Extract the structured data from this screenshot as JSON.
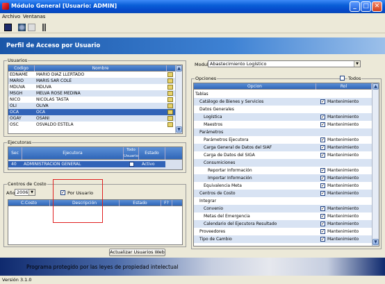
{
  "window": {
    "title": "Módulo General [Usuario: ADMIN]",
    "min": "_",
    "max": "□",
    "close": "✕"
  },
  "menu": [
    "Archivo",
    "Ventanas"
  ],
  "banner": {
    "title": "Perfil de Acceso por Usuario"
  },
  "usuarios": {
    "label": "Usuarios",
    "columns": [
      "Codigo",
      "Nombre"
    ],
    "rows": [
      {
        "codigo": "EDNAME",
        "nombre": "MARIO DIAZ LLERTADO",
        "sel": false
      },
      {
        "codigo": "MARIO",
        "nombre": "MARIS SAR COLE",
        "sel": false
      },
      {
        "codigo": "MDUVA",
        "nombre": "MDUVA",
        "sel": false
      },
      {
        "codigo": "MSGH",
        "nombre": "MELVA ROSE MEDINA",
        "sel": false
      },
      {
        "codigo": "NICO",
        "nombre": "NICOLAS TASTA",
        "sel": false
      },
      {
        "codigo": "OLI",
        "nombre": "OLIVA",
        "sel": false
      },
      {
        "codigo": "OCA",
        "nombre": "OCA",
        "sel": true
      },
      {
        "codigo": "OGAY",
        "nombre": "OSANI",
        "sel": false
      },
      {
        "codigo": "OSC",
        "nombre": "OSVALDO ESTELA",
        "sel": false
      }
    ]
  },
  "ejecutoras": {
    "label": "Ejecutoras",
    "columns": [
      "Sec",
      "Ejecutora",
      "Todo Usuario",
      "Estado"
    ],
    "rows": [
      {
        "sec": "40",
        "ejecutora": "ADMINISTRACION GENERAL",
        "estado": "Activo"
      }
    ]
  },
  "centro": {
    "label": "Centros de Costo",
    "year_label": "Año",
    "year": "2006",
    "filter_label": "Por Usuario",
    "filter_checked": true,
    "columns": [
      "C.Costo",
      "Descripción",
      "Estado",
      "F?"
    ]
  },
  "modulo": {
    "label": "Modulo",
    "value": "Abastecimiento Logístico"
  },
  "opciones": {
    "label": "Opciones",
    "todos_label": "Todos",
    "columns": [
      "Opcion",
      "Rol"
    ],
    "rows": [
      {
        "text": "Tablas",
        "indent": 0,
        "rol": "",
        "chk": false
      },
      {
        "text": "Catálogo de Bienes y Servicios",
        "indent": 1,
        "rol": "Mantenimiento",
        "chk": true
      },
      {
        "text": "Datos Generales",
        "indent": 1,
        "rol": "",
        "chk": false
      },
      {
        "text": "Logística",
        "indent": 2,
        "rol": "Mantenimiento",
        "chk": true
      },
      {
        "text": "Maestros",
        "indent": 2,
        "rol": "Mantenimiento",
        "chk": true
      },
      {
        "text": "Parámetros",
        "indent": 1,
        "rol": "",
        "chk": false
      },
      {
        "text": "Parámetros Ejecutora",
        "indent": 2,
        "rol": "Mantenimiento",
        "chk": true
      },
      {
        "text": "Carga General de Datos del SIAF",
        "indent": 2,
        "rol": "Mantenimiento",
        "chk": true
      },
      {
        "text": "Carga de Datos del SIGA",
        "indent": 2,
        "rol": "Mantenimiento",
        "chk": true
      },
      {
        "text": "Consumiciones",
        "indent": 2,
        "rol": "",
        "chk": false
      },
      {
        "text": "Reportar Información",
        "indent": 3,
        "rol": "Mantenimiento",
        "chk": true
      },
      {
        "text": "Importar Información",
        "indent": 3,
        "rol": "Mantenimiento",
        "chk": true
      },
      {
        "text": "Equivalencia Meta",
        "indent": 2,
        "rol": "Mantenimiento",
        "chk": true
      },
      {
        "text": "Centros de Costo",
        "indent": 1,
        "rol": "Mantenimiento",
        "chk": true
      },
      {
        "text": "Integrar",
        "indent": 1,
        "rol": "",
        "chk": false
      },
      {
        "text": "Convenio",
        "indent": 2,
        "rol": "Mantenimiento",
        "chk": true
      },
      {
        "text": "Metas del Emergencia",
        "indent": 2,
        "rol": "Mantenimiento",
        "chk": true
      },
      {
        "text": "Calendario del Ejecutora Resultado",
        "indent": 2,
        "rol": "Mantenimiento",
        "chk": true
      },
      {
        "text": "Proveedores",
        "indent": 1,
        "rol": "Mantenimiento",
        "chk": true
      },
      {
        "text": "Tipo de Cambio",
        "indent": 1,
        "rol": "Mantenimiento",
        "chk": true
      }
    ]
  },
  "actions": {
    "actualizar": "Actualizar Usuarios Web"
  },
  "legal": "Programa protegido por las leyes de propiedad intelectual",
  "status": "Versión 3.1.0"
}
